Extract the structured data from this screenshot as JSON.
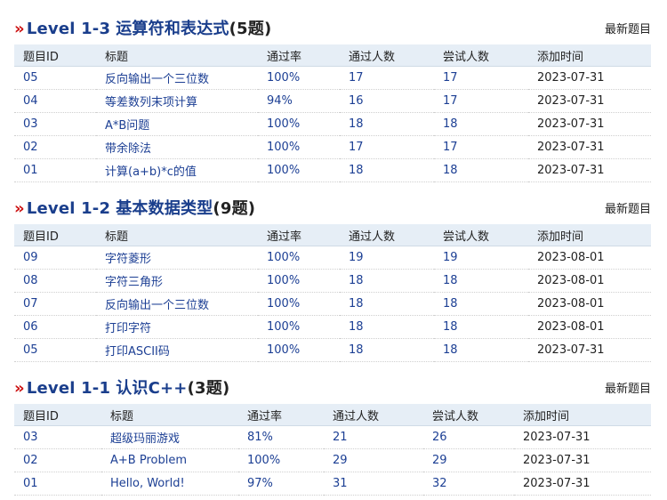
{
  "sections": [
    {
      "level": "Level 1-3",
      "name": "运算符和表达式",
      "count": "(5题)",
      "more_label": "最新题目",
      "headers": [
        "题目ID",
        "标题",
        "通过率",
        "通过人数",
        "尝试人数",
        "添加时间"
      ],
      "rows": [
        {
          "id": "05",
          "title": "反向输出一个三位数",
          "rate": "100%",
          "pass": "17",
          "try": "17",
          "date": "2023-07-31"
        },
        {
          "id": "04",
          "title": "等差数列末项计算",
          "rate": "94%",
          "pass": "16",
          "try": "17",
          "date": "2023-07-31"
        },
        {
          "id": "03",
          "title": "A*B问题",
          "rate": "100%",
          "pass": "18",
          "try": "18",
          "date": "2023-07-31"
        },
        {
          "id": "02",
          "title": "带余除法",
          "rate": "100%",
          "pass": "17",
          "try": "17",
          "date": "2023-07-31"
        },
        {
          "id": "01",
          "title": "计算(a+b)*c的值",
          "rate": "100%",
          "pass": "18",
          "try": "18",
          "date": "2023-07-31"
        }
      ]
    },
    {
      "level": "Level 1-2",
      "name": "基本数据类型",
      "count": "(9题)",
      "more_label": "最新题目",
      "headers": [
        "题目ID",
        "标题",
        "通过率",
        "通过人数",
        "尝试人数",
        "添加时间"
      ],
      "rows": [
        {
          "id": "09",
          "title": "字符菱形",
          "rate": "100%",
          "pass": "19",
          "try": "19",
          "date": "2023-08-01"
        },
        {
          "id": "08",
          "title": "字符三角形",
          "rate": "100%",
          "pass": "18",
          "try": "18",
          "date": "2023-08-01"
        },
        {
          "id": "07",
          "title": "反向输出一个三位数",
          "rate": "100%",
          "pass": "18",
          "try": "18",
          "date": "2023-08-01"
        },
        {
          "id": "06",
          "title": "打印字符",
          "rate": "100%",
          "pass": "18",
          "try": "18",
          "date": "2023-08-01"
        },
        {
          "id": "05",
          "title": "打印ASCII码",
          "rate": "100%",
          "pass": "18",
          "try": "18",
          "date": "2023-07-31"
        }
      ]
    },
    {
      "level": "Level 1-1",
      "name": "认识C++",
      "count": "(3题)",
      "more_label": "最新题目",
      "headers": [
        "题目ID",
        "标题",
        "通过率",
        "通过人数",
        "尝试人数",
        "添加时间"
      ],
      "rows": [
        {
          "id": "03",
          "title": "超级玛丽游戏",
          "rate": "81%",
          "pass": "21",
          "try": "26",
          "date": "2023-07-31"
        },
        {
          "id": "02",
          "title": "A+B Problem",
          "rate": "100%",
          "pass": "29",
          "try": "29",
          "date": "2023-07-31"
        },
        {
          "id": "01",
          "title": "Hello, World!",
          "rate": "97%",
          "pass": "31",
          "try": "32",
          "date": "2023-07-31"
        }
      ]
    }
  ],
  "colors": {
    "title": "#1a3e8c",
    "marker": "#cc1111",
    "link": "#1c3f94",
    "header_bg": "#e6eef6"
  },
  "icons": {
    "section_marker": "double-chevron-right-icon"
  }
}
